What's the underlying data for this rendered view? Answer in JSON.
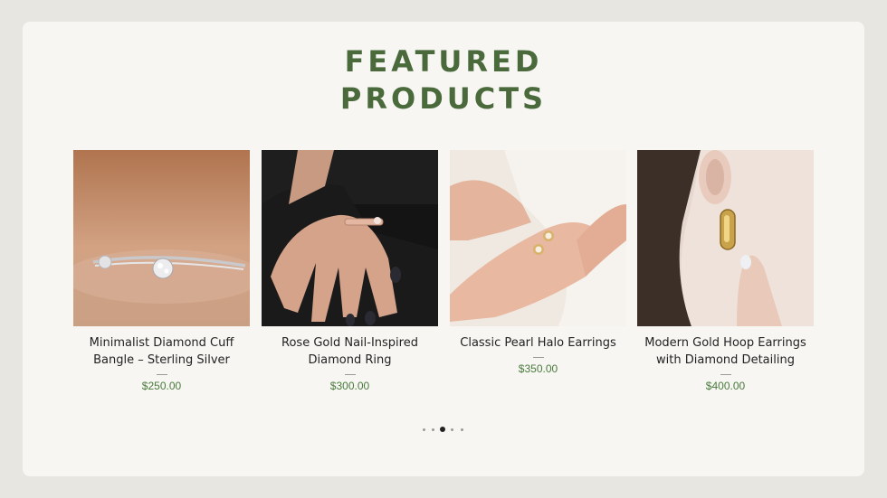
{
  "section": {
    "title_line1": "FEATURED",
    "title_line2": "PRODUCTS"
  },
  "products": [
    {
      "name": "Minimalist Diamond Cuff Bangle – Sterling Silver",
      "price": "$250.00",
      "image_icon": "silver-bangle-image"
    },
    {
      "name": "Rose Gold Nail-Inspired Diamond Ring",
      "price": "$300.00",
      "image_icon": "rose-gold-ring-image"
    },
    {
      "name": "Classic Pearl Halo Earrings",
      "price": "$350.00",
      "image_icon": "pearl-earrings-image"
    },
    {
      "name": "Modern Gold Hoop Earrings with Diamond Detailing",
      "price": "$400.00",
      "image_icon": "gold-hoop-earrings-image"
    }
  ],
  "carousel": {
    "page_count": 5,
    "active_index": 2
  },
  "colors": {
    "accent": "#4a6a3c",
    "price": "#4a7a3c",
    "panel_bg": "#f7f6f3",
    "page_bg": "#e7e6e0"
  }
}
